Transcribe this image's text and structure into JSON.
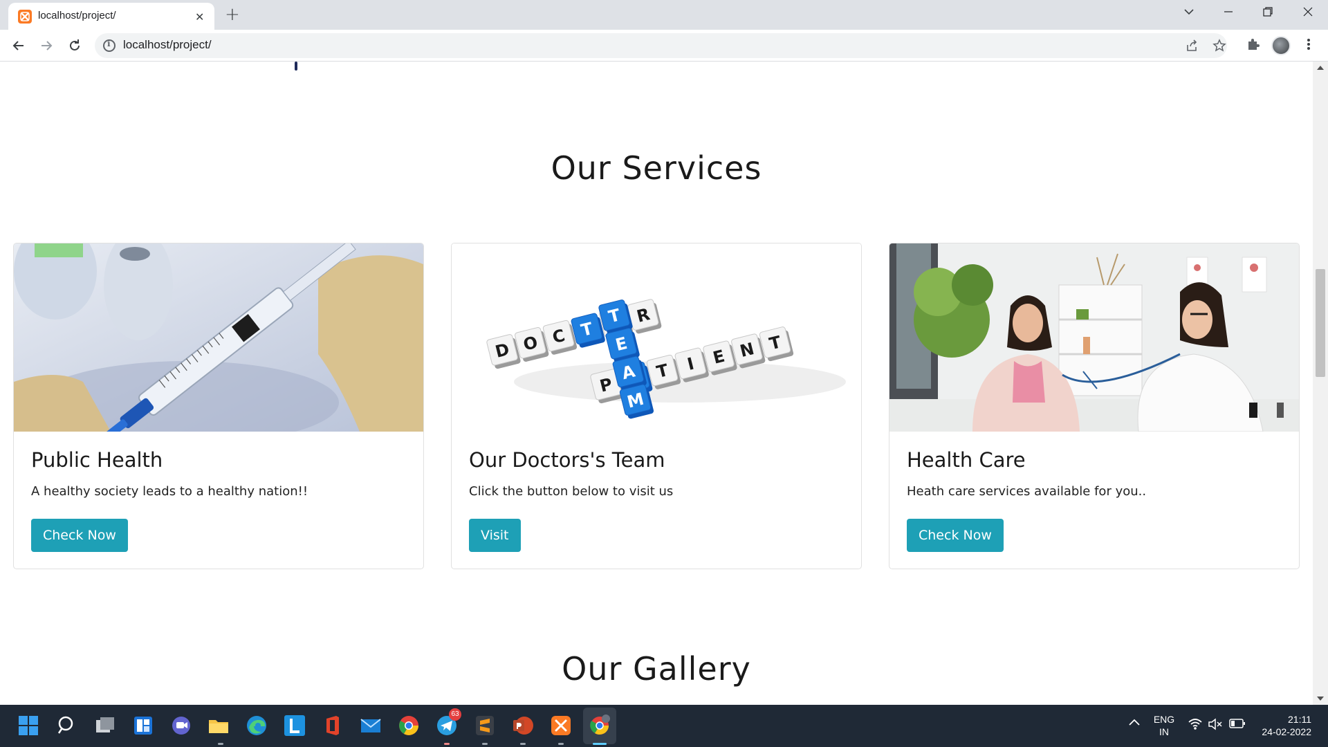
{
  "browser": {
    "tab_title": "localhost/project/",
    "url": "localhost/project/"
  },
  "page": {
    "services_title": "Our Services",
    "gallery_title": "Our Gallery",
    "cards": [
      {
        "title": "Public Health",
        "text": "A healthy society leads to a healthy nation!!",
        "button": "Check Now"
      },
      {
        "title": "Our Doctors's Team",
        "text": "Click the button below to visit us",
        "button": "Visit"
      },
      {
        "title": "Health Care",
        "text": "Heath care services available for you..",
        "button": "Check Now"
      }
    ],
    "team_tiles": {
      "doctor": [
        "D",
        "O",
        "C",
        "T",
        "O",
        "R"
      ],
      "patient": [
        "P",
        "A",
        "T",
        "I",
        "E",
        "N",
        "T"
      ],
      "team": [
        "T",
        "E",
        "A",
        "M"
      ]
    },
    "accent_color": "#1ea0b6"
  },
  "taskbar": {
    "telegram_badge": "63",
    "tray_lang_top": "ENG",
    "tray_lang_bottom": "IN",
    "time": "21:11",
    "date": "24-02-2022"
  }
}
